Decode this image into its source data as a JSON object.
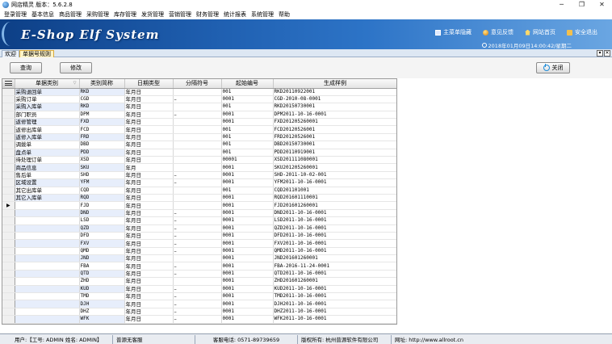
{
  "window": {
    "title": "网店精灵  版本：5.6.2.8",
    "controls": [
      "─",
      "❐",
      "✕"
    ]
  },
  "menu": [
    "登录管理",
    "基本信息",
    "商品管理",
    "采购管理",
    "库存管理",
    "发货管理",
    "营销管理",
    "财务管理",
    "统计报表",
    "系统管理",
    "帮助"
  ],
  "banner": {
    "logo": "E-Shop Elf System",
    "links": [
      "主菜单隐藏",
      "意见反馈",
      "网站首页",
      "安全退出"
    ],
    "datetime": "2018年01月09日14:00:42/星期二"
  },
  "tabs": [
    "欢迎",
    "单据号规则"
  ],
  "active_tab": "单据号规则",
  "toolbar": {
    "query_label": "查询",
    "edit_label": "修改",
    "close_label": "关闭"
  },
  "table": {
    "columns": [
      "单据类别",
      "类别简称",
      "日期类型",
      "分隔符号",
      "起始编号",
      "生成样例"
    ],
    "current_row_marker": "▶",
    "current_row_index": 15,
    "rows": [
      [
        "采购退回单",
        "RKD",
        "年月日",
        "",
        "001",
        "RKD20110922001"
      ],
      [
        "采购订单",
        "CGD",
        "年月日",
        "–",
        "0001",
        "CGD-2010-08-0001"
      ],
      [
        "采购入库单",
        "RKD",
        "年月日",
        "",
        "001",
        "RKD20150730001"
      ],
      [
        "部门职员",
        "DPM",
        "年月日",
        "–",
        "0001",
        "DPM2011-10-16-0001"
      ],
      [
        "返修管理",
        "FXD",
        "年月日",
        "",
        "0001",
        "FXD201205260001"
      ],
      [
        "返修出库单",
        "FCD",
        "年月日",
        "",
        "001",
        "FCD20120526001"
      ],
      [
        "返修入库单",
        "FRD",
        "年月日",
        "",
        "001",
        "FRD20120526001"
      ],
      [
        "调拨单",
        "DBD",
        "年月日",
        "",
        "001",
        "DBD20150730001"
      ],
      [
        "盘点单",
        "PDD",
        "年月日",
        "",
        "001",
        "PDD20110919001"
      ],
      [
        "待处理订单",
        "XSD",
        "年月日",
        "",
        "00001",
        "XSD201111080001"
      ],
      [
        "商品信息",
        "SKU",
        "年月",
        "",
        "0001",
        "SKU201205260001"
      ],
      [
        "售后单",
        "SHD",
        "年月日",
        "–",
        "0001",
        "SHD-2011-10-02-001"
      ],
      [
        "区域设置",
        "YFM",
        "年月日",
        "–",
        "0001",
        "YFM2011-10-16-0001"
      ],
      [
        "其它出库单",
        "CQD",
        "年月日",
        "",
        "001",
        "CQD201101001"
      ],
      [
        "其它入库单",
        "RQD",
        "年月日",
        "",
        "0001",
        "RQD201601110001"
      ],
      [
        "",
        "FJD",
        "年月日",
        "",
        "0001",
        "FJD201601260001"
      ],
      [
        "",
        "DND",
        "年月日",
        "–",
        "0001",
        "DND2011-10-16-0001"
      ],
      [
        "",
        "LSD",
        "年月日",
        "–",
        "0001",
        "LSD2011-10-16-0001"
      ],
      [
        "",
        "QZD",
        "年月日",
        "–",
        "0001",
        "QZD2011-10-16-0001"
      ],
      [
        "",
        "DFD",
        "年月日",
        "–",
        "0001",
        "DFD2011-10-16-0001"
      ],
      [
        "",
        "FXV",
        "年月日",
        "–",
        "0001",
        "FXV2011-10-16-0001"
      ],
      [
        "",
        "QMD",
        "年月日",
        "–",
        "0001",
        "QMD2011-10-16-0001"
      ],
      [
        "",
        "JND",
        "年月日",
        "",
        "0001",
        "JND201601260001"
      ],
      [
        "",
        "FBA",
        "年月日",
        "–",
        "0001",
        "FBA-2016-11-24-0001"
      ],
      [
        "",
        "QTD",
        "年月日",
        "–",
        "0001",
        "QTD2011-10-16-0001"
      ],
      [
        "",
        "ZHD",
        "年月日",
        "",
        "0001",
        "ZHD201601260001"
      ],
      [
        "",
        "KUD",
        "年月日",
        "–",
        "0001",
        "KUD2011-10-16-0001"
      ],
      [
        "",
        "TMD",
        "年月日",
        "–",
        "0001",
        "TMD2011-10-16-0001"
      ],
      [
        "",
        "DJH",
        "年月日",
        "–",
        "0001",
        "DJH2011-10-16-0001"
      ],
      [
        "",
        "DHZ",
        "年月日",
        "–",
        "0001",
        "DHZ2011-10-16-0001"
      ],
      [
        "",
        "WFK",
        "年月日",
        "–",
        "0001",
        "WFK2011-10-16-0001"
      ]
    ]
  },
  "status": {
    "user": "用户:【工号: ADMIN  姓名: ADMIN】",
    "support": "普源无客服",
    "phone": "客服电话: 0571-89739659",
    "copyright": "版权所有: 杭州普源软件有限公司",
    "website": "网址: http://www.allroot.cn"
  },
  "colors": {
    "banner_dark": "#0d3f86",
    "banner_light": "#6aa6e2",
    "row_highlight": "#e7eefb",
    "active_tab": "#fff4c8"
  }
}
